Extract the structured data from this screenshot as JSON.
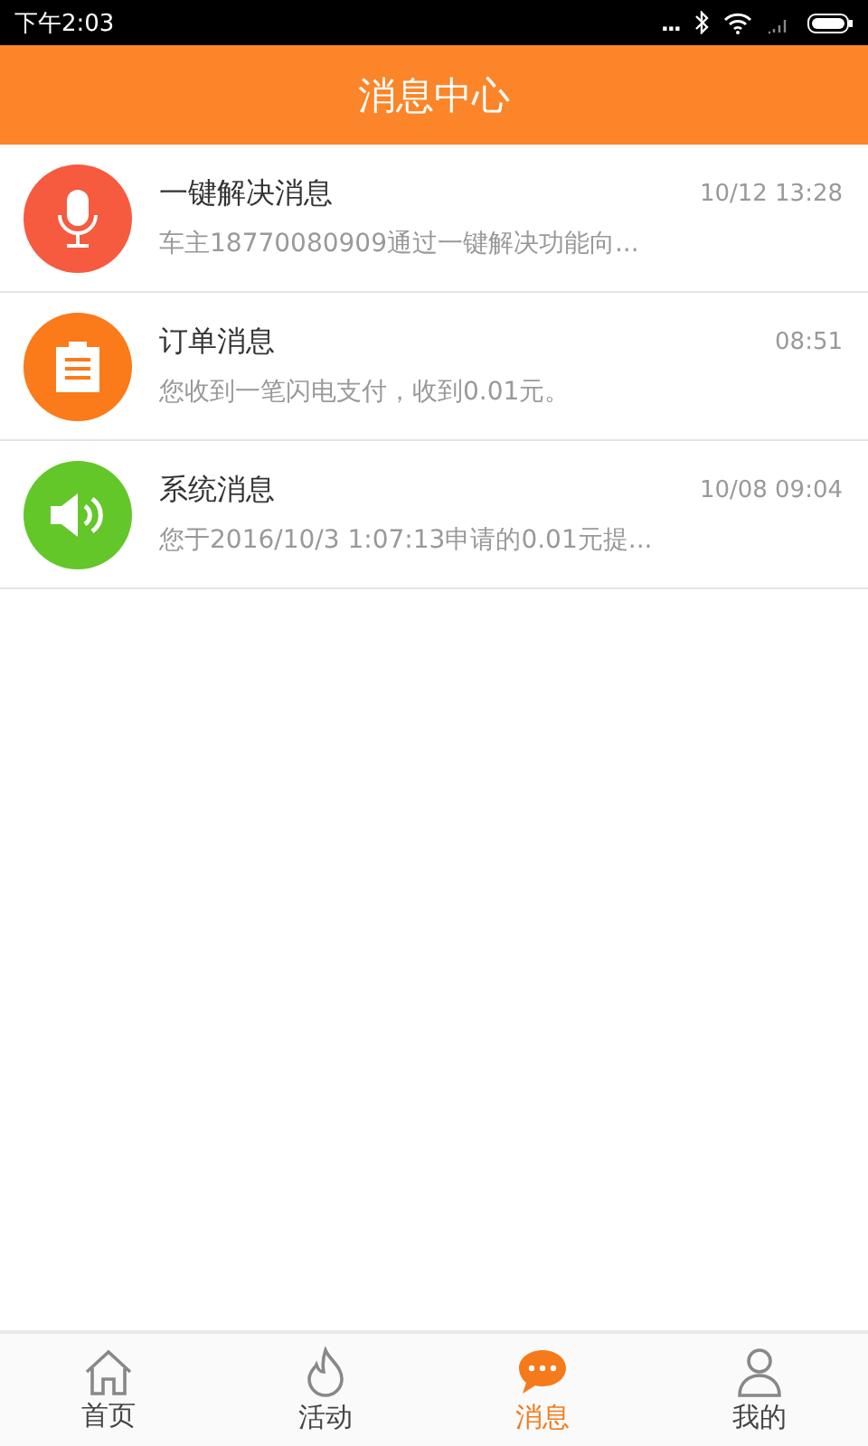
{
  "status_bar": {
    "time": "下午2:03",
    "overflow": "..."
  },
  "header": {
    "title": "消息中心"
  },
  "messages": [
    {
      "kind": "mic",
      "color": "#f65a3f",
      "title": "一键解决消息",
      "time": "10/12 13:28",
      "preview": "车主18770080909通过一键解决功能向..."
    },
    {
      "kind": "clipboard",
      "color": "#fb7a1a",
      "title": "订单消息",
      "time": "08:51",
      "preview": "您收到一笔闪电支付，收到0.01元。"
    },
    {
      "kind": "speaker",
      "color": "#63c629",
      "title": "系统消息",
      "time": "10/08 09:04",
      "preview": "您于2016/10/3 1:07:13申请的0.01元提..."
    }
  ],
  "tabs": [
    {
      "kind": "home",
      "label": "首页",
      "selected": false
    },
    {
      "kind": "flame",
      "label": "活动",
      "selected": false
    },
    {
      "kind": "chat",
      "label": "消息",
      "selected": true
    },
    {
      "kind": "person",
      "label": "我的",
      "selected": false
    }
  ]
}
